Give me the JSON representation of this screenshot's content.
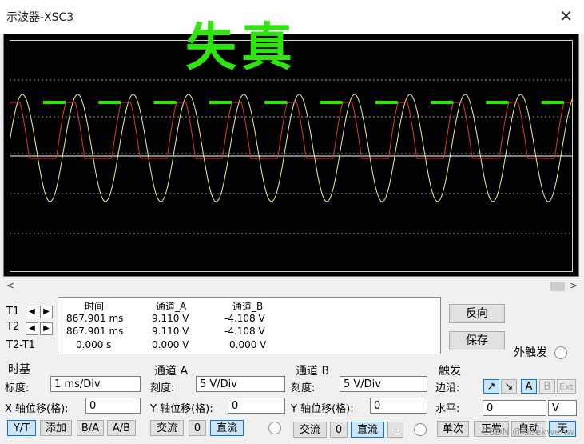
{
  "window": {
    "title": "示波器-XSC3",
    "close_icon": "close-icon"
  },
  "overlay_text": "失真",
  "cursors": {
    "t1": "T1",
    "t2": "T2",
    "t2t1": "T2-T1"
  },
  "readout": {
    "headers": [
      "时间",
      "通道_A",
      "通道_B"
    ],
    "rows": [
      [
        "867.901 ms",
        "9.110 V",
        "-4.108 V"
      ],
      [
        "867.901 ms",
        "9.110 V",
        "-4.108 V"
      ],
      [
        "0.000 s",
        "0.000 V",
        "0.000 V"
      ]
    ]
  },
  "actions": {
    "reverse": "反向",
    "save": "保存",
    "ext_trigger": "外触发"
  },
  "timebase": {
    "title": "时基",
    "scale_label": "标度:",
    "scale_value": "1 ms/Div",
    "xpos_label": "X 轴位移(格):",
    "xpos_value": "0",
    "modes": [
      "Y/T",
      "添加",
      "B/A",
      "A/B"
    ],
    "selected_mode": "Y/T"
  },
  "channel_a": {
    "title": "通道 A",
    "scale_label": "刻度:",
    "scale_value": "5  V/Div",
    "ypos_label": "Y 轴位移(格):",
    "ypos_value": "0",
    "coupling": [
      "交流",
      "0",
      "直流"
    ],
    "selected": "直流"
  },
  "channel_b": {
    "title": "通道 B",
    "scale_label": "刻度:",
    "scale_value": "5  V/Div",
    "ypos_label": "Y 轴位移(格):",
    "ypos_value": "0",
    "coupling": [
      "交流",
      "0",
      "直流",
      "-"
    ],
    "selected": "直流"
  },
  "trigger": {
    "title": "触发",
    "edge_label": "边沿:",
    "level_label": "水平:",
    "level_value": "0",
    "level_unit": "V",
    "sources": [
      "A",
      "B",
      "Ext"
    ],
    "selected_source": "A",
    "modes": [
      "单次",
      "正常",
      "自动",
      "无"
    ],
    "selected_mode": "无"
  },
  "watermark": "CSDN @Geekwenw",
  "colors": {
    "trace_a": "#e23a2a",
    "trace_b": "#f2eea0",
    "overlay": "#2ee60e",
    "grid": "#9a9a9a"
  }
}
